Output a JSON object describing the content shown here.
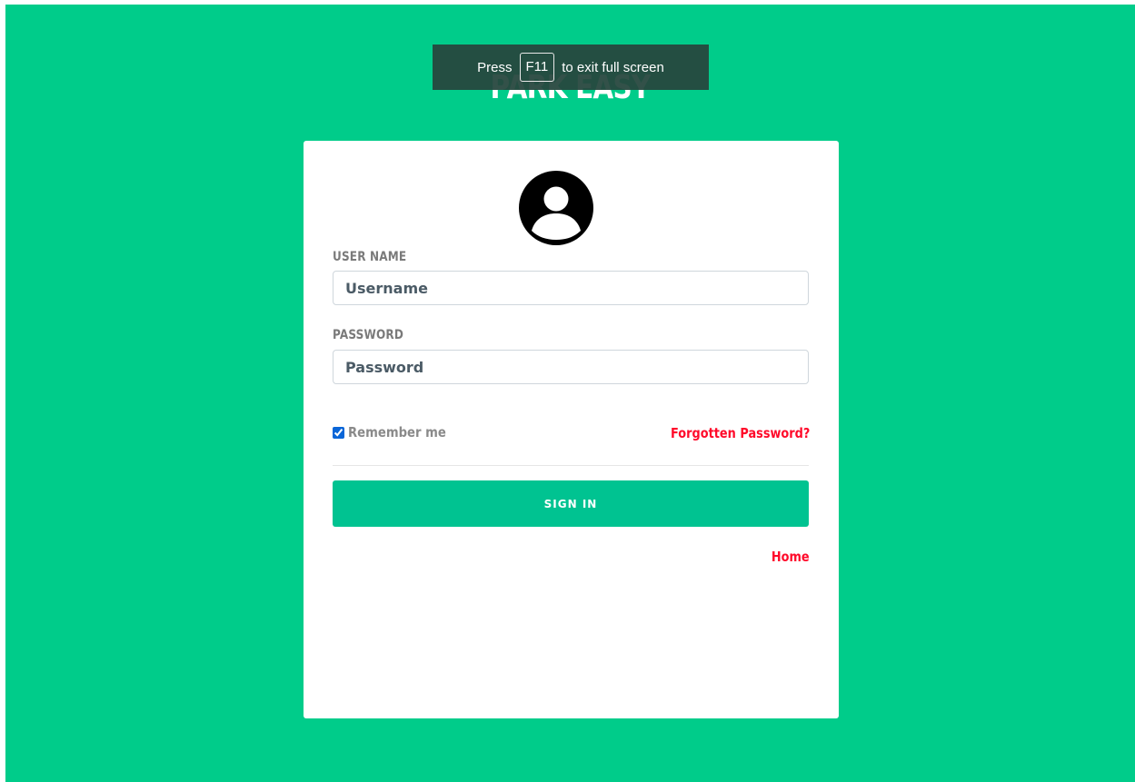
{
  "app": {
    "brand": "PARK EASY"
  },
  "fullscreen_notice": {
    "prefix": "Press",
    "key": "F11",
    "suffix": "to exit full screen"
  },
  "login": {
    "avatar_icon": "user-circle-icon",
    "username_label": "USER NAME",
    "username_placeholder": "Username",
    "username_value": "",
    "password_label": "PASSWORD",
    "password_placeholder": "Password",
    "password_value": "",
    "remember_label": "Remember me",
    "remember_checked": true,
    "forgot_link": "Forgotten Password?",
    "signin_label": "SIGN IN",
    "home_link": "Home"
  },
  "colors": {
    "background": "#00cc8a",
    "button": "#00c391",
    "link": "#ff0a2a",
    "label": "#7a7a7a"
  }
}
